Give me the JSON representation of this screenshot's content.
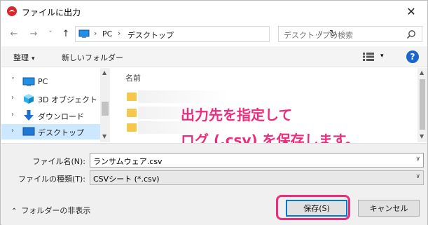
{
  "window": {
    "title": "ファイルに出力",
    "close_glyph": "✕"
  },
  "nav": {
    "back_glyph": "←",
    "forward_glyph": "→",
    "recent_glyph": "˅",
    "up_glyph": "↑",
    "path": [
      "PC",
      "デスクトップ"
    ],
    "separator": "›",
    "dropdown_glyph": "∨",
    "refresh_glyph": "↻",
    "search_placeholder": "デスクトップの検索"
  },
  "toolbar": {
    "organize": "整理",
    "organize_caret": "▾",
    "new_folder": "新しいフォルダー",
    "view_caret": "▾",
    "help_glyph": "?"
  },
  "tree": {
    "items": [
      {
        "label": "PC",
        "arrow": "˅",
        "icon": "computer-icon"
      },
      {
        "label": "3D オブジェクト",
        "arrow": "›",
        "icon": "cube-icon"
      },
      {
        "label": "ダウンロード",
        "arrow": "›",
        "icon": "download-icon"
      },
      {
        "label": "デスクトップ",
        "arrow": "›",
        "icon": "desktop-icon"
      }
    ],
    "scroll_up": "▲",
    "scroll_down": "▼"
  },
  "files": {
    "column_name": "名前"
  },
  "annotation": {
    "line1": "出力先を指定して",
    "line2": "ログ (.csv) を保存します。"
  },
  "form": {
    "filename_label": "ファイル名(N):",
    "filename_value": "ランサムウェア.csv",
    "filetype_label": "ファイルの種類(T):",
    "filetype_value": "CSVシート (*.csv)",
    "dropdown_glyph": "∨"
  },
  "footer": {
    "hide_folders": "フォルダーの非表示",
    "hide_caret": "⌃",
    "save": "保存(S)",
    "cancel": "キャンセル"
  },
  "colors": {
    "accent": "#0078d7",
    "annotation": "#ec2d7d",
    "selected": "#cce8ff"
  }
}
